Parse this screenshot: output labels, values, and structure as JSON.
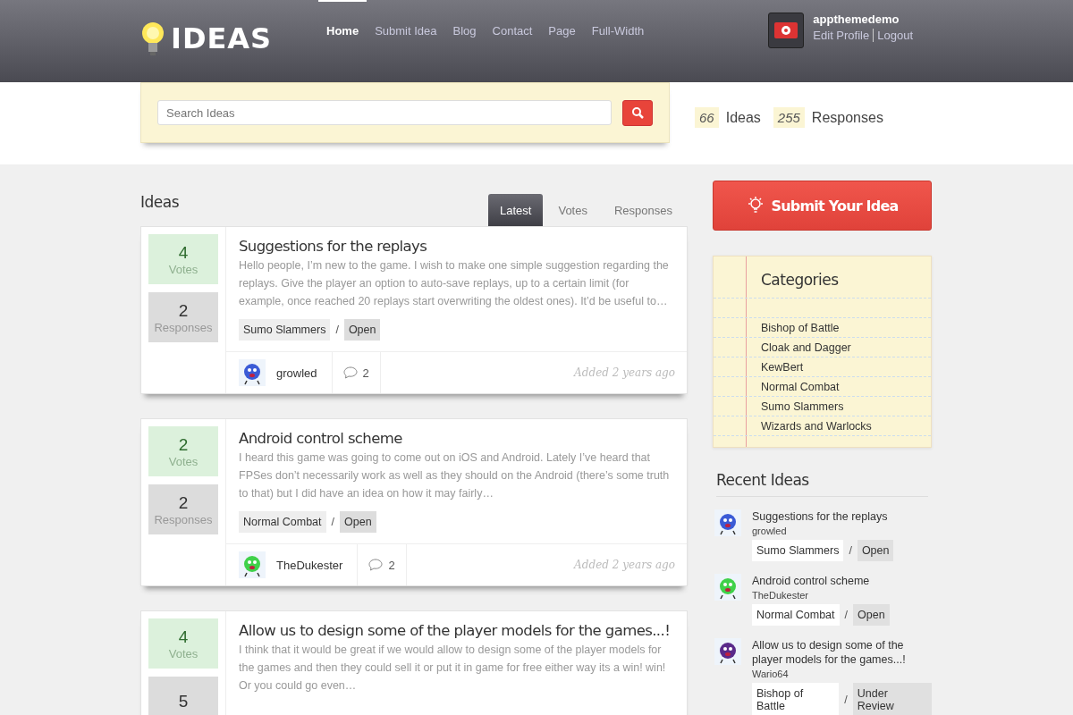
{
  "header": {
    "logo": "IDEAS",
    "nav": [
      {
        "label": "Home",
        "selected": true
      },
      {
        "label": "Submit Idea",
        "selected": false
      },
      {
        "label": "Blog",
        "selected": false
      },
      {
        "label": "Contact",
        "selected": false
      },
      {
        "label": "Page",
        "selected": false
      },
      {
        "label": "Full-Width",
        "selected": false
      }
    ],
    "user": {
      "name": "appthemedemo",
      "links": [
        "Edit Profile",
        "Logout"
      ]
    }
  },
  "search": {
    "placeholder": "Search Ideas"
  },
  "stats": [
    {
      "count": "66",
      "label": "Ideas"
    },
    {
      "count": "255",
      "label": "Responses"
    }
  ],
  "ideas_heading": "Ideas",
  "sort_tabs": [
    {
      "label": "Latest",
      "selected": true
    },
    {
      "label": "Votes",
      "selected": false
    },
    {
      "label": "Responses",
      "selected": false
    }
  ],
  "ideas": [
    {
      "votes": "4",
      "votes_label": "Votes",
      "responses": "2",
      "responses_label": "Responses",
      "title": "Suggestions for the replays",
      "excerpt": "Hello people, I’m new to the game. I wish to make one simple suggestion regarding the replays. Give the player an option to auto-save replays, up to a certain limit (for example, once reached 20 replays start overwriting the oldest ones). It’d be useful to…",
      "category": "Sumo Slammers",
      "separator": "/",
      "status": "Open",
      "author": "growled",
      "comments": "2",
      "added": "Added 2 years ago"
    },
    {
      "votes": "2",
      "votes_label": "Votes",
      "responses": "2",
      "responses_label": "Responses",
      "title": "Android control scheme",
      "excerpt": "I heard this game was going to come out on iOS and Android. Lately I’ve heard that FPSes don’t necessarily work as well as they should on the Android (there’s some truth to that) but I did have an idea on how it may fairly…",
      "category": "Normal Combat",
      "separator": "/",
      "status": "Open",
      "author": "TheDukester",
      "comments": "2",
      "added": "Added 2 years ago"
    },
    {
      "votes": "4",
      "votes_label": "Votes",
      "responses": "5",
      "title": "Allow us to design some of the player models for the games...!",
      "excerpt": "I think that it would be great if we would allow to design some of the player models for the games and then they could sell it or put it in game for free either way its a win! win! Or you could go even…"
    }
  ],
  "submit_button": "Submit Your Idea",
  "categories": {
    "title": "Categories",
    "items": [
      "Bishop of Battle",
      "Cloak and Dagger",
      "KewBert",
      "Normal Combat",
      "Sumo Slammers",
      "Wizards and Warlocks"
    ]
  },
  "recent": {
    "title": "Recent Ideas",
    "items": [
      {
        "title": "Suggestions for the replays",
        "author": "growled",
        "category": "Sumo Slammers",
        "separator": "/",
        "status": "Open"
      },
      {
        "title": "Android control scheme",
        "author": "TheDukester",
        "category": "Normal Combat",
        "separator": "/",
        "status": "Open"
      },
      {
        "title": "Allow us to design some of the player models for the games...!",
        "author": "Wario64",
        "category": "Bishop of Battle",
        "separator": "/",
        "status": "Under Review"
      }
    ]
  }
}
